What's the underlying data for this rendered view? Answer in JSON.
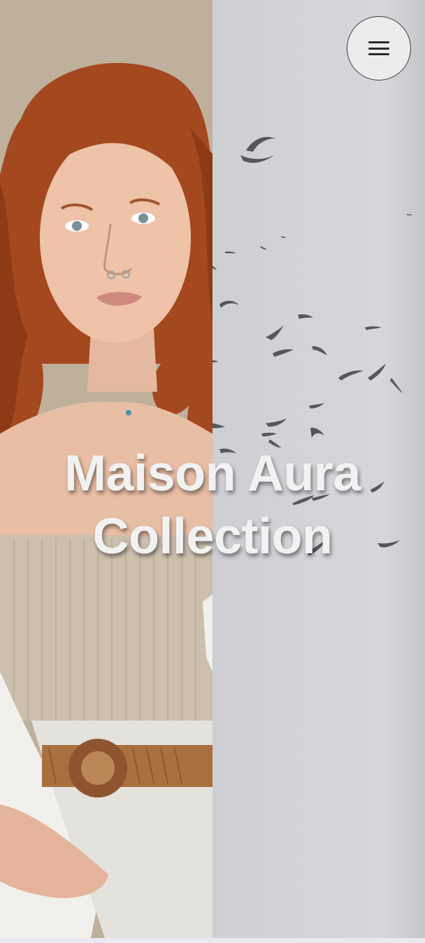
{
  "hero": {
    "title_line1": "Maison Aura",
    "title_line2": "Collection"
  },
  "nav": {
    "menu_icon": "hamburger-menu-icon"
  },
  "colors": {
    "title_text": "#f2f2f2",
    "sky_background": "#d2d4d8",
    "bird": "#55575d",
    "hair": "#a4481f"
  }
}
